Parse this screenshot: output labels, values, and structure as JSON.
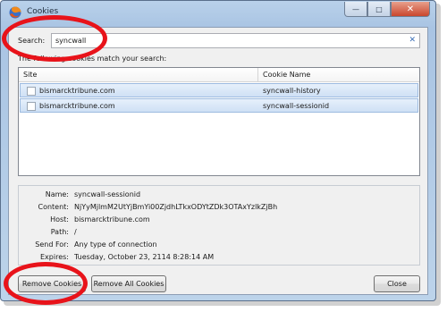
{
  "window": {
    "title": "Cookies"
  },
  "search": {
    "label": "Search:",
    "value": "syncwall",
    "clear_glyph": "✕"
  },
  "hint": "The following cookies match your search:",
  "table": {
    "columns": [
      "Site",
      "Cookie Name"
    ],
    "rows": [
      {
        "site": "bismarcktribune.com",
        "cookie": "syncwall-history"
      },
      {
        "site": "bismarcktribune.com",
        "cookie": "syncwall-sessionid"
      }
    ]
  },
  "details": [
    {
      "key": "Name:",
      "value": "syncwall-sessionid"
    },
    {
      "key": "Content:",
      "value": "NjYyMjlmM2UtYjBmYi00ZjdhLTkxODYtZDk3OTAxYzlkZjBh"
    },
    {
      "key": "Host:",
      "value": "bismarcktribune.com"
    },
    {
      "key": "Path:",
      "value": "/"
    },
    {
      "key": "Send For:",
      "value": "Any type of connection"
    },
    {
      "key": "Expires:",
      "value": "Tuesday, October 23, 2114 8:28:14 AM"
    }
  ],
  "buttons": {
    "remove": "Remove Cookies",
    "remove_all": "Remove All Cookies",
    "close": "Close"
  },
  "colors": {
    "highlight_ring": "#e8131a",
    "selection": "#cfe0f5"
  },
  "icons": {
    "app": "firefox-icon",
    "minimize": "minimize-icon",
    "maximize": "maximize-icon",
    "close": "close-icon"
  }
}
